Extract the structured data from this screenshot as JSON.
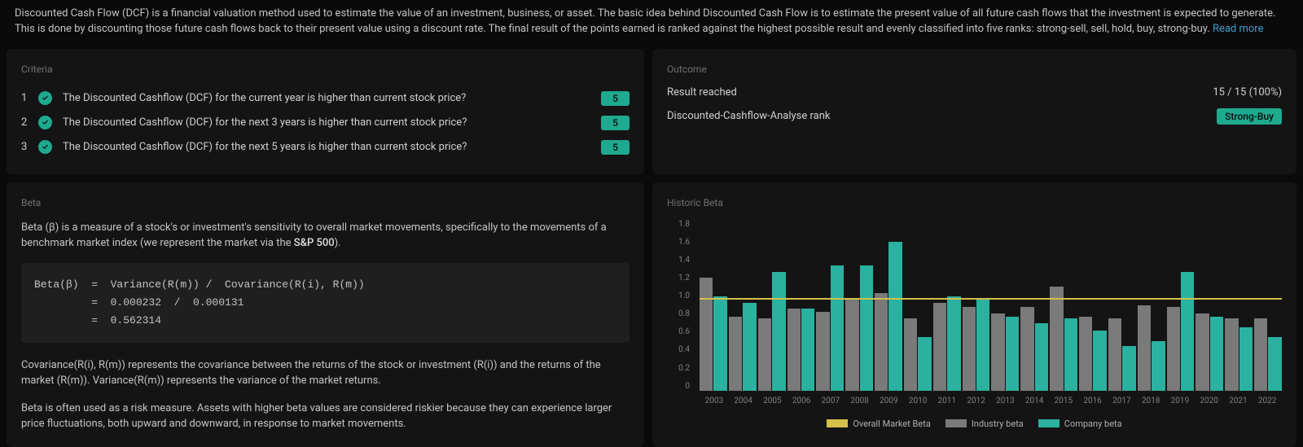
{
  "intro": {
    "text": "Discounted Cash Flow (DCF) is a financial valuation method used to estimate the value of an investment, business, or asset. The basic idea behind Discounted Cash Flow is to estimate the present value of all future cash flows that the investment is expected to generate. This is done by discounting those future cash flows back to their present value using a discount rate. The final result of the points earned is ranked against the highest possible result and evenly classified into five ranks: strong-sell, sell, hold, buy, strong-buy. ",
    "read_more": "Read more"
  },
  "criteria": {
    "title": "Criteria",
    "items": [
      {
        "num": "1",
        "label": "The Discounted Cashflow (DCF) for the current year is higher than current stock price?",
        "score": "5"
      },
      {
        "num": "2",
        "label": "The Discounted Cashflow (DCF) for the next 3 years is higher than current stock price?",
        "score": "5"
      },
      {
        "num": "3",
        "label": "The Discounted Cashflow (DCF) for the next 5 years is higher than current stock price?",
        "score": "5"
      }
    ]
  },
  "outcome": {
    "title": "Outcome",
    "rows": [
      {
        "label": "Result reached",
        "value": "15 / 15 (100%)"
      },
      {
        "label": "Discounted-Cashflow-Analyse rank",
        "badge": "Strong-Buy"
      }
    ]
  },
  "beta_panel": {
    "title": "Beta",
    "p1_a": "Beta (β) is a measure of a stock's or investment's sensitivity to overall market movements, specifically to the movements of a benchmark market index (we represent the market via the ",
    "p1_bold": "S&P 500",
    "p1_b": ").",
    "formula": "Beta(β)  =  Variance(R(m)) /  Covariance(R(i), R(m))\n         =  0.000232  /  0.000131\n         =  0.562314",
    "p2": "Covariance(R(i), R(m)) represents the covariance between the returns of the stock or investment (R(i)) and the returns of the market (R(m)). Variance(R(m)) represents the variance of the market returns.",
    "p3": "Beta is often used as a risk measure. Assets with higher beta values are considered riskier because they can experience larger price fluctuations, both upward and downward, in response to market movements."
  },
  "historic": {
    "title": "Historic Beta",
    "legend": {
      "overall": "Overall Market Beta",
      "industry": "Industry beta",
      "company": "Company beta"
    }
  },
  "chart_data": {
    "type": "bar",
    "title": "Historic Beta",
    "ylabel": "",
    "xlabel": "",
    "ylim": [
      0,
      1.8
    ],
    "yticks": [
      1.8,
      1.6,
      1.4,
      1.2,
      1.0,
      0.8,
      0.6,
      0.4,
      0.2,
      0
    ],
    "categories": [
      "2003",
      "2004",
      "2005",
      "2006",
      "2007",
      "2008",
      "2009",
      "2010",
      "2011",
      "2012",
      "2013",
      "2014",
      "2015",
      "2016",
      "2017",
      "2018",
      "2019",
      "2020",
      "2021",
      "2022"
    ],
    "baseline": {
      "name": "Overall Market Beta",
      "value": 1.0
    },
    "series": [
      {
        "name": "Industry beta",
        "values": [
          1.22,
          0.8,
          0.78,
          0.88,
          0.85,
          1.0,
          1.05,
          0.78,
          0.95,
          0.9,
          0.83,
          0.9,
          1.12,
          0.8,
          0.78,
          0.92,
          0.9,
          0.83,
          0.78,
          0.78
        ]
      },
      {
        "name": "Company beta",
        "values": [
          1.02,
          0.95,
          1.28,
          0.88,
          1.35,
          1.35,
          1.6,
          0.58,
          1.02,
          1.0,
          0.8,
          0.73,
          0.78,
          0.65,
          0.48,
          0.53,
          1.28,
          0.8,
          0.68,
          0.58
        ]
      }
    ]
  }
}
